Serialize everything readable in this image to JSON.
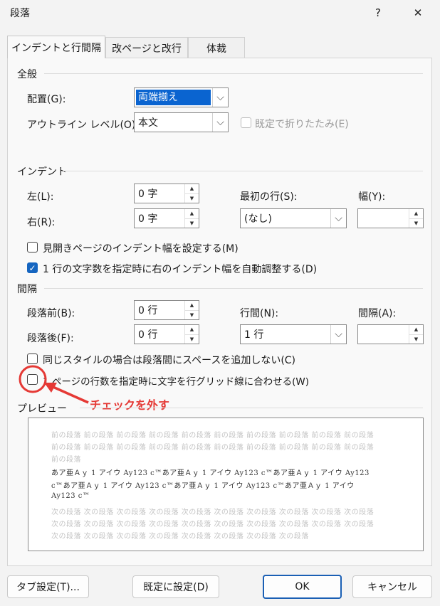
{
  "window": {
    "title": "段落",
    "help_label": "?",
    "close_label": "✕"
  },
  "tabs": [
    {
      "label": "インデントと行間隔"
    },
    {
      "label": "改ページと改行"
    },
    {
      "label": "体裁"
    }
  ],
  "general": {
    "section_label": "全般",
    "alignment_label": "配置(G):",
    "alignment_value": "両端揃え",
    "outline_label": "アウトライン レベル(O):",
    "outline_value": "本文",
    "collapsed_label": "既定で折りたたみ(E)"
  },
  "indent": {
    "section_label": "インデント",
    "left_label": "左(L):",
    "left_value": "0 字",
    "right_label": "右(R):",
    "right_value": "0 字",
    "first_line_label": "最初の行(S):",
    "first_line_value": "(なし)",
    "width_label": "幅(Y):",
    "width_value": "",
    "mirror_label": "見開きページのインデント幅を設定する(M)",
    "auto_adjust_label": "1 行の文字数を指定時に右のインデント幅を自動調整する(D)"
  },
  "spacing": {
    "section_label": "間隔",
    "before_label": "段落前(B):",
    "before_value": "0 行",
    "after_label": "段落後(F):",
    "after_value": "0 行",
    "line_spacing_label": "行間(N):",
    "line_spacing_value": "1 行",
    "at_label": "間隔(A):",
    "at_value": "",
    "no_space_same_style_label": "同じスタイルの場合は段落間にスペースを追加しない(C)",
    "snap_to_grid_label": "1 ページの行数を指定時に文字を行グリッド線に合わせる(W)"
  },
  "annotation": {
    "text": "チェックを外す",
    "color": "#e53935"
  },
  "preview": {
    "section_label": "プレビュー",
    "prev_lines": [
      "前の段落 前の段落 前の段落 前の段落 前の段落 前の段落 前の段落 前の段落 前の段落 前の段落",
      "前の段落 前の段落 前の段落 前の段落 前の段落 前の段落 前の段落 前の段落 前の段落 前の段落",
      "前の段落"
    ],
    "main_lines": [
      "あア亜Ａｙ 1 アイウ Ay123 c™あア亜Ａｙ 1 アイウ Ay123 c™あア亜Ａｙ 1 アイウ Ay123",
      "c™あア亜Ａｙ 1 アイウ Ay123 c™あア亜Ａｙ 1 アイウ Ay123 c™あア亜Ａｙ 1 アイウ",
      "Ay123 c™"
    ],
    "next_lines": [
      "次の段落 次の段落 次の段落 次の段落 次の段落 次の段落 次の段落 次の段落 次の段落 次の段落",
      "次の段落 次の段落 次の段落 次の段落 次の段落 次の段落 次の段落 次の段落 次の段落 次の段落",
      "次の段落 次の段落 次の段落 次の段落 次の段落 次の段落 次の段落 次の段落"
    ]
  },
  "buttons": {
    "tabs_label": "タブ設定(T)...",
    "default_label": "既定に設定(D)",
    "ok_label": "OK",
    "cancel_label": "キャンセル"
  }
}
